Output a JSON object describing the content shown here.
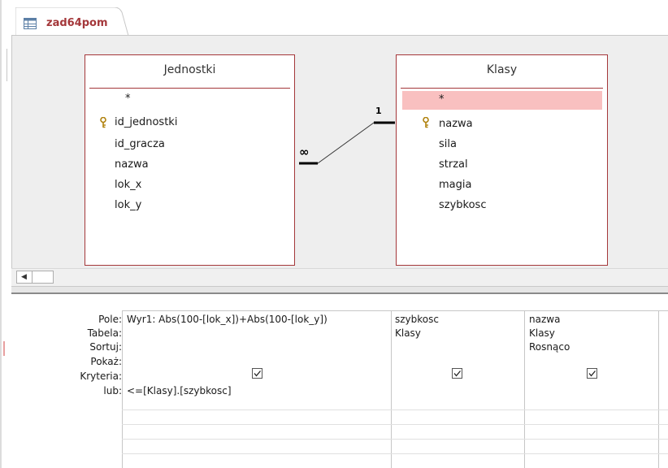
{
  "tab": {
    "title": "zad64pom",
    "icon": "query-icon"
  },
  "tables": [
    {
      "title": "Jednostki",
      "fields": [
        "*",
        "id_jednostki",
        "id_gracza",
        "nazwa",
        "lok_x",
        "lok_y"
      ],
      "key_field": "id_jednostki"
    },
    {
      "title": "Klasy",
      "fields": [
        "*",
        "nazwa",
        "sila",
        "strzal",
        "magia",
        "szybkosc"
      ],
      "key_field": "nazwa",
      "selected_field": "*"
    }
  ],
  "relationship": {
    "one_label": "1",
    "many_label": "∞"
  },
  "colors": {
    "accent": "#a4373a",
    "selection": "#f9c0c0"
  },
  "grid": {
    "row_labels": {
      "field": "Pole:",
      "table": "Tabela:",
      "sort": "Sortuj:",
      "show": "Pokaż:",
      "criteria": "Kryteria:",
      "or": "lub:"
    },
    "columns": [
      {
        "field": "Wyr1: Abs(100-[lok_x])+Abs(100-[lok_y])",
        "table": "",
        "sort": "",
        "show": true,
        "criteria": "<=[Klasy].[szybkosc]"
      },
      {
        "field": "szybkosc",
        "table": "Klasy",
        "sort": "",
        "show": true,
        "criteria": ""
      },
      {
        "field": "nazwa",
        "table": "Klasy",
        "sort": "Rosnąco",
        "show": true,
        "criteria": ""
      }
    ]
  }
}
